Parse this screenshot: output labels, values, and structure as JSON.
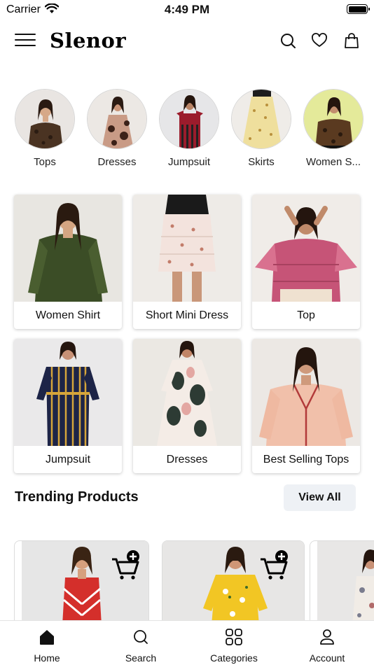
{
  "status_bar": {
    "carrier": "Carrier",
    "time": "4:49 PM"
  },
  "header": {
    "logo": "Slenor",
    "icons": [
      "menu-icon",
      "search-icon",
      "heart-icon",
      "bag-icon"
    ]
  },
  "categories": [
    {
      "label": "Tops"
    },
    {
      "label": "Dresses"
    },
    {
      "label": "Jumpsuit"
    },
    {
      "label": "Skirts"
    },
    {
      "label": "Women S..."
    }
  ],
  "grid": [
    {
      "label": "Women Shirt"
    },
    {
      "label": "Short Mini Dress"
    },
    {
      "label": "Top"
    },
    {
      "label": "Jumpsuit"
    },
    {
      "label": "Dresses"
    },
    {
      "label": "Best Selling Tops"
    }
  ],
  "trending": {
    "title": "Trending Products",
    "view_all": "View All"
  },
  "tab_bar": [
    {
      "label": "Home",
      "icon": "home-icon",
      "active": true
    },
    {
      "label": "Search",
      "icon": "search-icon",
      "active": false
    },
    {
      "label": "Categories",
      "icon": "categories-icon",
      "active": false
    },
    {
      "label": "Account",
      "icon": "account-icon",
      "active": false
    }
  ],
  "colors": {
    "accent": "#111111",
    "view_all_bg": "#eef1f5",
    "tile_shadow": "#d8d8d8"
  }
}
